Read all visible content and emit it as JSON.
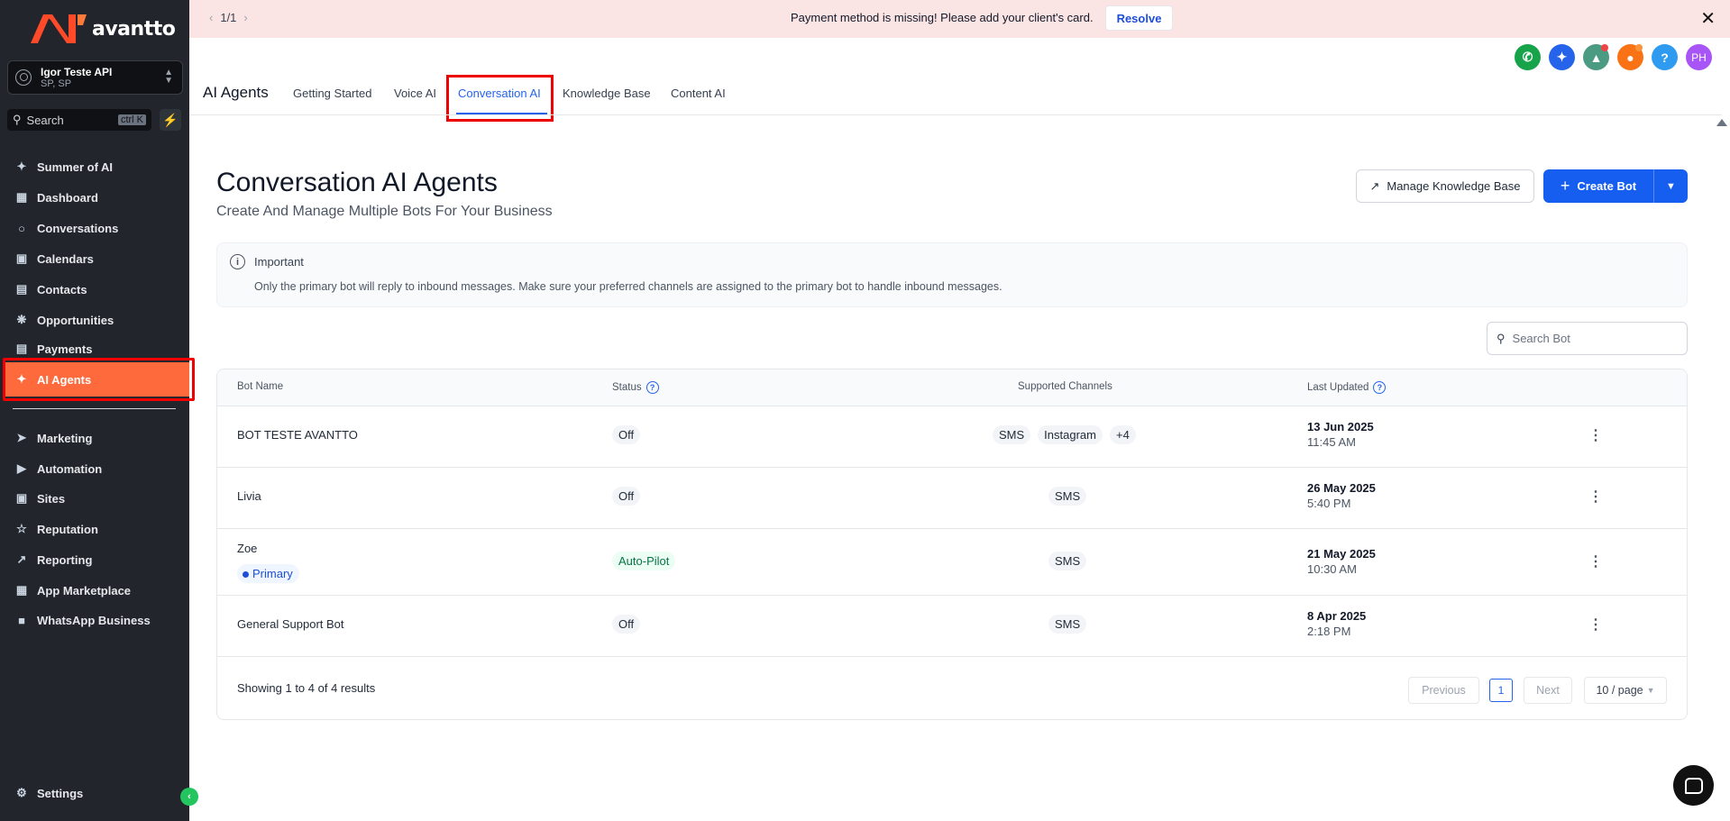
{
  "brand": {
    "name": "avantto"
  },
  "account": {
    "name": "Igor Teste API",
    "location": "SP, SP"
  },
  "search": {
    "placeholder": "Search",
    "shortcut": "ctrl K"
  },
  "sidebar": {
    "items": [
      {
        "label": "Summer of AI",
        "icon": "sparkle-icon"
      },
      {
        "label": "Dashboard",
        "icon": "grid-icon"
      },
      {
        "label": "Conversations",
        "icon": "chat-icon"
      },
      {
        "label": "Calendars",
        "icon": "calendar-icon"
      },
      {
        "label": "Contacts",
        "icon": "contacts-icon"
      },
      {
        "label": "Opportunities",
        "icon": "funnel-icon"
      },
      {
        "label": "Payments",
        "icon": "receipt-icon"
      },
      {
        "label": "AI Agents",
        "icon": "sparkle-icon",
        "active": true
      }
    ],
    "items2": [
      {
        "label": "Marketing",
        "icon": "send-icon"
      },
      {
        "label": "Automation",
        "icon": "automation-icon"
      },
      {
        "label": "Sites",
        "icon": "globe-icon"
      },
      {
        "label": "Reputation",
        "icon": "star-icon"
      },
      {
        "label": "Reporting",
        "icon": "trend-icon"
      },
      {
        "label": "App Marketplace",
        "icon": "apps-icon"
      },
      {
        "label": "WhatsApp Business",
        "icon": "whatsapp-icon"
      }
    ],
    "settings_label": "Settings"
  },
  "banner": {
    "pager": "1/1",
    "message": "Payment method is missing! Please add your client's card.",
    "resolve_label": "Resolve"
  },
  "topbar": {
    "avatar_initials": "PH",
    "help_label": "?",
    "colors": {
      "phone": "#16a34a",
      "ai": "#2563eb",
      "announce": "#4b9a82",
      "bell": "#f97316",
      "help": "#2f9bf0",
      "avatar": "#a855f7"
    }
  },
  "header": {
    "title": "AI Agents",
    "tabs": [
      {
        "label": "Getting Started"
      },
      {
        "label": "Voice AI"
      },
      {
        "label": "Conversation AI",
        "active": true
      },
      {
        "label": "Knowledge Base"
      },
      {
        "label": "Content AI"
      }
    ]
  },
  "main": {
    "title": "Conversation AI Agents",
    "subtitle": "Create And Manage Multiple Bots For Your Business",
    "manage_kb_label": "Manage Knowledge Base",
    "create_bot_label": "Create Bot",
    "notice": {
      "title": "Important",
      "text": "Only the primary bot will reply to inbound messages. Make sure your preferred channels are assigned to the primary bot to handle inbound messages."
    },
    "search_placeholder": "Search Bot"
  },
  "table": {
    "headers": {
      "name": "Bot Name",
      "status": "Status",
      "channels": "Supported Channels",
      "updated": "Last Updated"
    },
    "rows": [
      {
        "name": "BOT TESTE AVANTTO",
        "status": "Off",
        "channels": [
          "SMS",
          "Instagram",
          "+4"
        ],
        "date": "13 Jun 2025",
        "time": "11:45 AM"
      },
      {
        "name": "Livia",
        "status": "Off",
        "channels": [
          "SMS"
        ],
        "date": "26 May 2025",
        "time": "5:40 PM"
      },
      {
        "name": "Zoe",
        "badge": "Primary",
        "status": "Auto-Pilot",
        "channels": [
          "SMS"
        ],
        "date": "21 May 2025",
        "time": "10:30 AM"
      },
      {
        "name": "General Support Bot",
        "status": "Off",
        "channels": [
          "SMS"
        ],
        "date": "8 Apr 2025",
        "time": "2:18 PM"
      }
    ],
    "footer": {
      "showing": "Showing 1 to 4 of 4 results",
      "previous": "Previous",
      "page": "1",
      "next": "Next",
      "per_page": "10 / page"
    }
  }
}
